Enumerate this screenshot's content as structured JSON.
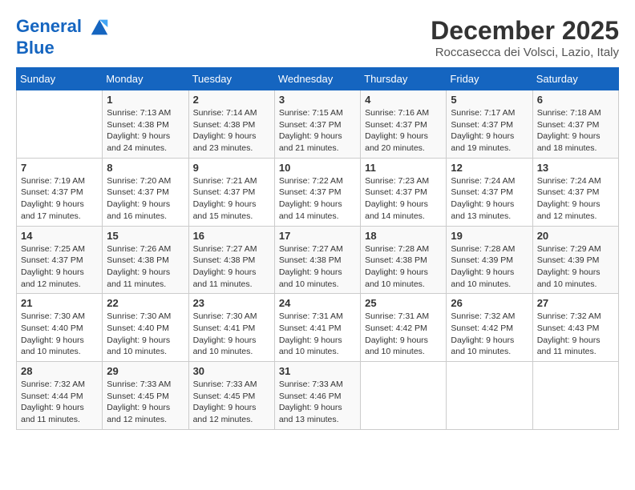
{
  "header": {
    "logo_line1": "General",
    "logo_line2": "Blue",
    "month": "December 2025",
    "location": "Roccasecca dei Volsci, Lazio, Italy"
  },
  "weekdays": [
    "Sunday",
    "Monday",
    "Tuesday",
    "Wednesday",
    "Thursday",
    "Friday",
    "Saturday"
  ],
  "weeks": [
    [
      {
        "day": "",
        "info": ""
      },
      {
        "day": "1",
        "info": "Sunrise: 7:13 AM\nSunset: 4:38 PM\nDaylight: 9 hours\nand 24 minutes."
      },
      {
        "day": "2",
        "info": "Sunrise: 7:14 AM\nSunset: 4:38 PM\nDaylight: 9 hours\nand 23 minutes."
      },
      {
        "day": "3",
        "info": "Sunrise: 7:15 AM\nSunset: 4:37 PM\nDaylight: 9 hours\nand 21 minutes."
      },
      {
        "day": "4",
        "info": "Sunrise: 7:16 AM\nSunset: 4:37 PM\nDaylight: 9 hours\nand 20 minutes."
      },
      {
        "day": "5",
        "info": "Sunrise: 7:17 AM\nSunset: 4:37 PM\nDaylight: 9 hours\nand 19 minutes."
      },
      {
        "day": "6",
        "info": "Sunrise: 7:18 AM\nSunset: 4:37 PM\nDaylight: 9 hours\nand 18 minutes."
      }
    ],
    [
      {
        "day": "7",
        "info": "Sunrise: 7:19 AM\nSunset: 4:37 PM\nDaylight: 9 hours\nand 17 minutes."
      },
      {
        "day": "8",
        "info": "Sunrise: 7:20 AM\nSunset: 4:37 PM\nDaylight: 9 hours\nand 16 minutes."
      },
      {
        "day": "9",
        "info": "Sunrise: 7:21 AM\nSunset: 4:37 PM\nDaylight: 9 hours\nand 15 minutes."
      },
      {
        "day": "10",
        "info": "Sunrise: 7:22 AM\nSunset: 4:37 PM\nDaylight: 9 hours\nand 14 minutes."
      },
      {
        "day": "11",
        "info": "Sunrise: 7:23 AM\nSunset: 4:37 PM\nDaylight: 9 hours\nand 14 minutes."
      },
      {
        "day": "12",
        "info": "Sunrise: 7:24 AM\nSunset: 4:37 PM\nDaylight: 9 hours\nand 13 minutes."
      },
      {
        "day": "13",
        "info": "Sunrise: 7:24 AM\nSunset: 4:37 PM\nDaylight: 9 hours\nand 12 minutes."
      }
    ],
    [
      {
        "day": "14",
        "info": "Sunrise: 7:25 AM\nSunset: 4:37 PM\nDaylight: 9 hours\nand 12 minutes."
      },
      {
        "day": "15",
        "info": "Sunrise: 7:26 AM\nSunset: 4:38 PM\nDaylight: 9 hours\nand 11 minutes."
      },
      {
        "day": "16",
        "info": "Sunrise: 7:27 AM\nSunset: 4:38 PM\nDaylight: 9 hours\nand 11 minutes."
      },
      {
        "day": "17",
        "info": "Sunrise: 7:27 AM\nSunset: 4:38 PM\nDaylight: 9 hours\nand 10 minutes."
      },
      {
        "day": "18",
        "info": "Sunrise: 7:28 AM\nSunset: 4:38 PM\nDaylight: 9 hours\nand 10 minutes."
      },
      {
        "day": "19",
        "info": "Sunrise: 7:28 AM\nSunset: 4:39 PM\nDaylight: 9 hours\nand 10 minutes."
      },
      {
        "day": "20",
        "info": "Sunrise: 7:29 AM\nSunset: 4:39 PM\nDaylight: 9 hours\nand 10 minutes."
      }
    ],
    [
      {
        "day": "21",
        "info": "Sunrise: 7:30 AM\nSunset: 4:40 PM\nDaylight: 9 hours\nand 10 minutes."
      },
      {
        "day": "22",
        "info": "Sunrise: 7:30 AM\nSunset: 4:40 PM\nDaylight: 9 hours\nand 10 minutes."
      },
      {
        "day": "23",
        "info": "Sunrise: 7:30 AM\nSunset: 4:41 PM\nDaylight: 9 hours\nand 10 minutes."
      },
      {
        "day": "24",
        "info": "Sunrise: 7:31 AM\nSunset: 4:41 PM\nDaylight: 9 hours\nand 10 minutes."
      },
      {
        "day": "25",
        "info": "Sunrise: 7:31 AM\nSunset: 4:42 PM\nDaylight: 9 hours\nand 10 minutes."
      },
      {
        "day": "26",
        "info": "Sunrise: 7:32 AM\nSunset: 4:42 PM\nDaylight: 9 hours\nand 10 minutes."
      },
      {
        "day": "27",
        "info": "Sunrise: 7:32 AM\nSunset: 4:43 PM\nDaylight: 9 hours\nand 11 minutes."
      }
    ],
    [
      {
        "day": "28",
        "info": "Sunrise: 7:32 AM\nSunset: 4:44 PM\nDaylight: 9 hours\nand 11 minutes."
      },
      {
        "day": "29",
        "info": "Sunrise: 7:33 AM\nSunset: 4:45 PM\nDaylight: 9 hours\nand 12 minutes."
      },
      {
        "day": "30",
        "info": "Sunrise: 7:33 AM\nSunset: 4:45 PM\nDaylight: 9 hours\nand 12 minutes."
      },
      {
        "day": "31",
        "info": "Sunrise: 7:33 AM\nSunset: 4:46 PM\nDaylight: 9 hours\nand 13 minutes."
      },
      {
        "day": "",
        "info": ""
      },
      {
        "day": "",
        "info": ""
      },
      {
        "day": "",
        "info": ""
      }
    ]
  ]
}
